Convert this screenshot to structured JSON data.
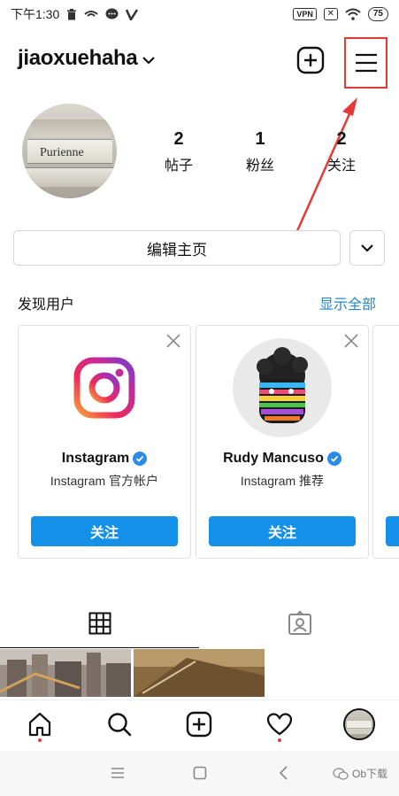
{
  "status_bar": {
    "time": "下午1:30",
    "vpn": "VPN",
    "battery": "75"
  },
  "header": {
    "username": "jiaoxuehaha"
  },
  "profile": {
    "avatar_book_title": "Purienne",
    "stats": [
      {
        "num": "2",
        "label": "帖子"
      },
      {
        "num": "1",
        "label": "粉丝"
      },
      {
        "num": "2",
        "label": "关注"
      }
    ],
    "edit_label": "编辑主页"
  },
  "discover": {
    "title": "发现用户",
    "see_all": "显示全部",
    "cards": [
      {
        "name": "Instagram",
        "subtitle": "Instagram 官方帐户",
        "follow": "关注"
      },
      {
        "name": "Rudy Mancuso",
        "subtitle": "Instagram 推荐",
        "follow": "关注"
      }
    ]
  },
  "watermark": "Ob下载",
  "colors": {
    "accent": "#1490e8",
    "link": "#1e88c8",
    "highlight": "#e53935"
  },
  "icons": {
    "header": [
      "chevron-down-icon",
      "add-post-icon",
      "menu-icon"
    ],
    "tabs": [
      "grid-icon",
      "tagged-icon"
    ],
    "bottom_nav": [
      "home-icon",
      "search-icon",
      "add-icon",
      "heart-icon",
      "profile-avatar"
    ]
  }
}
